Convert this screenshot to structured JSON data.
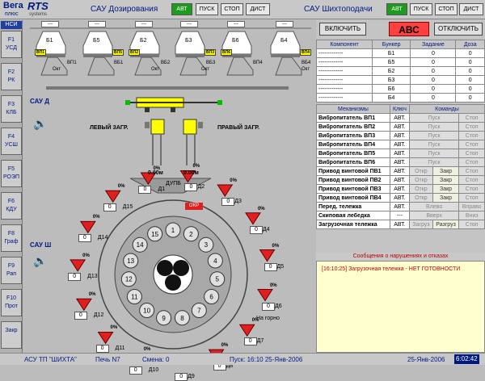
{
  "header": {
    "brand": "Вега",
    "rts": "RTS",
    "sub": "плюс",
    "sub2": "systems",
    "title1": "САУ Дозирования",
    "title2": "САУ Шихтоподачи",
    "btn_avt": "АВТ",
    "btn_pusk": "ПУСК",
    "btn_stop": "СТОП",
    "btn_dist": "ДИСТ"
  },
  "sidebar": {
    "nsi": "НСИ",
    "keys": [
      "F1\nУСД",
      "F2\nРК",
      "F3\nКЛБ",
      "F4\nУСШ",
      "F5\nРОЭП",
      "F6\nКДУ",
      "F8\nГраф",
      "F9\nРап",
      "F10\nПрот",
      "Закр"
    ]
  },
  "diagram": {
    "top_slots": [
      "---",
      "---",
      "---",
      "---",
      "---",
      "---"
    ],
    "bunkers": [
      "Б1",
      "Б5",
      "Б2",
      "Б3",
      "Б6",
      "Б4"
    ],
    "vb_tags": [
      "ВП1",
      "ВП5",
      "ВП2",
      "ВП3",
      "ВП6",
      "ВП4"
    ],
    "vb_lower": [
      "ВП1",
      "ВБ1",
      "ВБ2",
      "ВБ3",
      "ВП4",
      "ВБ4"
    ],
    "okt": [
      "Окт",
      "Окт",
      "Окт",
      "Окт"
    ],
    "sau_d": "САУ Д",
    "sau_sh": "САУ Ш",
    "left_load": "ЛЕВЫЙ ЗАГР.",
    "right_load": "ПРАВЫЙ ЗАГР.",
    "left_m": "0.00м",
    "right_m": "0.00м",
    "dupb": "ДУПБ",
    "okr": "ОКР",
    "na_gorno": "На горно",
    "pct": "0%",
    "zero": "0",
    "d_labels": [
      "Д1",
      "Д2",
      "Д3",
      "Д4",
      "Д5",
      "Д6",
      "Д7",
      "Д8",
      "Д9",
      "Д10",
      "Д11",
      "Д12",
      "Д13",
      "Д14",
      "Д15"
    ],
    "ring": [
      "1",
      "2",
      "3",
      "4",
      "5",
      "6",
      "7",
      "8",
      "9",
      "10",
      "11",
      "12",
      "13",
      "14",
      "15"
    ]
  },
  "right": {
    "enable_btn": "ВКЛЮЧИТЬ",
    "abc": "АВС",
    "disable_btn": "ОТКЛЮЧИТЬ",
    "comp_headers": [
      "Компонент",
      "Бункер",
      "Задание",
      "Доза"
    ],
    "comp_rows": [
      [
        "-------------",
        "Б1",
        "0",
        "0"
      ],
      [
        "-------------",
        "Б5",
        "0",
        "0"
      ],
      [
        "-------------",
        "Б2",
        "0",
        "0"
      ],
      [
        "-------------",
        "Б3",
        "0",
        "0"
      ],
      [
        "-------------",
        "Б6",
        "0",
        "0"
      ],
      [
        "-------------",
        "Б4",
        "0",
        "0"
      ]
    ],
    "mech_headers": [
      "Механизмы",
      "Ключ",
      "Команды"
    ],
    "mech_rows": [
      {
        "n": "Вибропитатель ВП1",
        "k": "АВТ.",
        "c": [
          "Пуск",
          "Стоп"
        ]
      },
      {
        "n": "Вибропитатель ВП2",
        "k": "АВТ.",
        "c": [
          "Пуск",
          "Стоп"
        ]
      },
      {
        "n": "Вибропитатель ВП3",
        "k": "АВТ.",
        "c": [
          "Пуск",
          "Стоп"
        ]
      },
      {
        "n": "Вибропитатель ВП4",
        "k": "АВТ.",
        "c": [
          "Пуск",
          "Стоп"
        ]
      },
      {
        "n": "Вибропитатель ВП5",
        "k": "АВТ.",
        "c": [
          "Пуск",
          "Стоп"
        ]
      },
      {
        "n": "Вибропитатель ВП6",
        "k": "АВТ.",
        "c": [
          "Пуск",
          "Стоп"
        ]
      },
      {
        "n": "Привод винтовой ПВ1",
        "k": "АВТ.",
        "c": [
          "Откр",
          "Закр",
          "Стоп"
        ]
      },
      {
        "n": "Привод винтовой ПВ2",
        "k": "АВТ.",
        "c": [
          "Откр",
          "Закр",
          "Стоп"
        ]
      },
      {
        "n": "Привод винтовой ПВ3",
        "k": "АВТ.",
        "c": [
          "Откр",
          "Закр",
          "Стоп"
        ]
      },
      {
        "n": "Привод винтовой ПВ4",
        "k": "АВТ.",
        "c": [
          "Откр",
          "Закр",
          "Стоп"
        ]
      },
      {
        "n": "Перед. тележка",
        "k": "АВТ.",
        "c": [
          "Влево",
          "Вправо"
        ]
      },
      {
        "n": "Скиповая лебедка",
        "k": "---",
        "c": [
          "Вверх",
          "Вниз"
        ]
      },
      {
        "n": "Загрузочная тележка",
        "k": "АВТ.",
        "c": [
          "Загруз",
          "Разгруз",
          "Стоп"
        ]
      }
    ],
    "msg_header": "Сообщения о нарушениях и отказах",
    "msg": "[16:10:25]  Загрузочная тележка - НЕТ ГОТОВНОСТИ"
  },
  "status": {
    "app": "АСУ ТП \"ШИХТА\"",
    "pech": "Печь N7",
    "smena": "Смена:  0",
    "pusk": "Пуск:  16:10  25-Янв-2006",
    "date": "25-Янв-2006",
    "time": "6:02:42"
  }
}
